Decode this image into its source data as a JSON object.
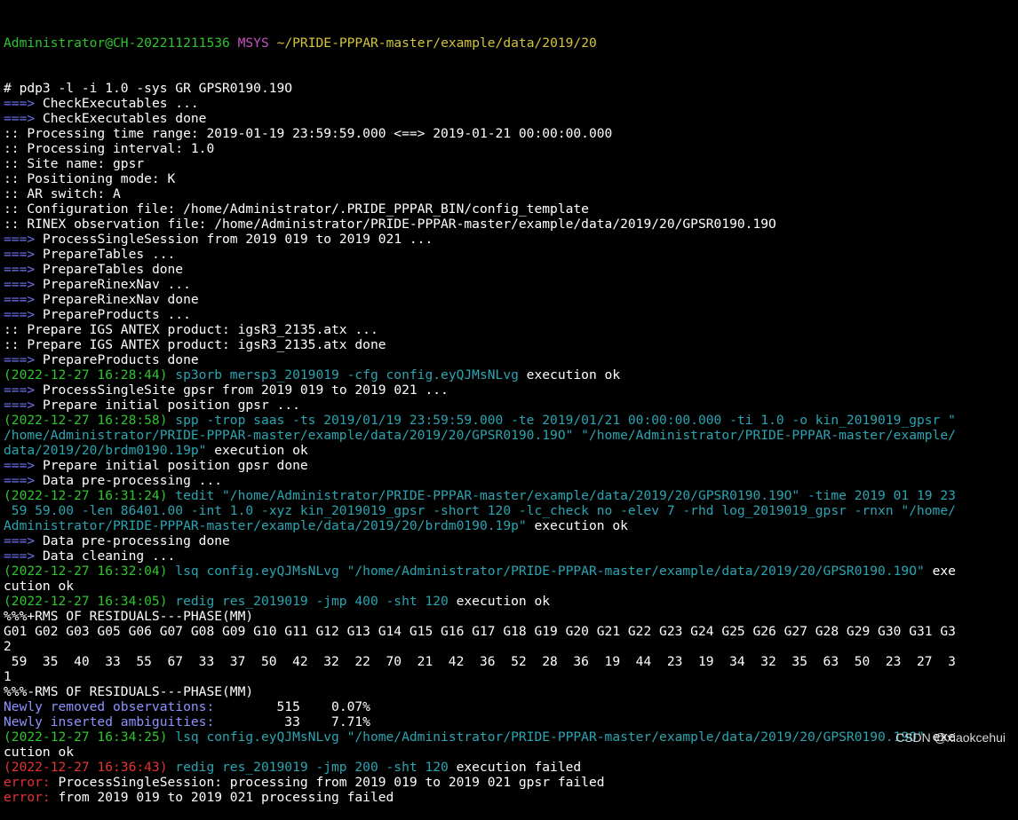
{
  "colors": {
    "background": "#000000",
    "default_text": "#ffffff",
    "prompt_user": "#2ec52e",
    "prompt_msys": "#c552c5",
    "prompt_path": "#d4c43a",
    "arrow": "#6f74f2",
    "timestamp": "#2ec52e",
    "command": "#2aa5b2",
    "error": "#e83232",
    "stats_label": "#8f93ff"
  },
  "prompt": {
    "user": "Administrator@CH-202211211536",
    "msys": "MSYS",
    "path": "~/PRIDE-PPPAR-master/example/data/2019/20"
  },
  "lines": [
    {
      "segments": [
        {
          "text": "# pdp3 -l -i 1.0 -sys GR GPSR0190.19O",
          "color": "white"
        }
      ]
    },
    {
      "segments": [
        {
          "text": "===>",
          "color": "blue"
        },
        {
          "text": " CheckExecutables ...",
          "color": "white"
        }
      ]
    },
    {
      "segments": [
        {
          "text": "===>",
          "color": "blue"
        },
        {
          "text": " CheckExecutables done",
          "color": "white"
        }
      ]
    },
    {
      "segments": [
        {
          "text": ":: Processing time range: 2019-01-19 23:59:59.000 <==> 2019-01-21 00:00:00.000",
          "color": "white"
        }
      ]
    },
    {
      "segments": [
        {
          "text": ":: Processing interval: 1.0",
          "color": "white"
        }
      ]
    },
    {
      "segments": [
        {
          "text": ":: Site name: gpsr",
          "color": "white"
        }
      ]
    },
    {
      "segments": [
        {
          "text": ":: Positioning mode: K",
          "color": "white"
        }
      ]
    },
    {
      "segments": [
        {
          "text": ":: AR switch: A",
          "color": "white"
        }
      ]
    },
    {
      "segments": [
        {
          "text": ":: Configuration file: /home/Administrator/.PRIDE_PPPAR_BIN/config_template",
          "color": "white"
        }
      ]
    },
    {
      "segments": [
        {
          "text": ":: RINEX observation file: /home/Administrator/PRIDE-PPPAR-master/example/data/2019/20/GPSR0190.19O",
          "color": "white"
        }
      ]
    },
    {
      "segments": [
        {
          "text": "===>",
          "color": "blue"
        },
        {
          "text": " ProcessSingleSession from 2019 019 to 2019 021 ...",
          "color": "white"
        }
      ]
    },
    {
      "segments": [
        {
          "text": "===>",
          "color": "blue"
        },
        {
          "text": " PrepareTables ...",
          "color": "white"
        }
      ]
    },
    {
      "segments": [
        {
          "text": "===>",
          "color": "blue"
        },
        {
          "text": " PrepareTables done",
          "color": "white"
        }
      ]
    },
    {
      "segments": [
        {
          "text": "===>",
          "color": "blue"
        },
        {
          "text": " PrepareRinexNav ...",
          "color": "white"
        }
      ]
    },
    {
      "segments": [
        {
          "text": "===>",
          "color": "blue"
        },
        {
          "text": " PrepareRinexNav done",
          "color": "white"
        }
      ]
    },
    {
      "segments": [
        {
          "text": "===>",
          "color": "blue"
        },
        {
          "text": " PrepareProducts ...",
          "color": "white"
        }
      ]
    },
    {
      "segments": [
        {
          "text": ":: Prepare IGS ANTEX product: igsR3_2135.atx ...",
          "color": "white"
        }
      ]
    },
    {
      "segments": [
        {
          "text": ":: Prepare IGS ANTEX product: igsR3_2135.atx done",
          "color": "white"
        }
      ]
    },
    {
      "segments": [
        {
          "text": "===>",
          "color": "blue"
        },
        {
          "text": " PrepareProducts done",
          "color": "white"
        }
      ]
    },
    {
      "segments": [
        {
          "text": "(2022-12-27 16:28:44) ",
          "color": "green"
        },
        {
          "text": "sp3orb mersp3_2019019 -cfg config.eyQJMsNLvg",
          "color": "teal"
        },
        {
          "text": " execution ok",
          "color": "white"
        }
      ]
    },
    {
      "segments": [
        {
          "text": "===>",
          "color": "blue"
        },
        {
          "text": " ProcessSingleSite gpsr from 2019 019 to 2019 021 ...",
          "color": "white"
        }
      ]
    },
    {
      "segments": [
        {
          "text": "===>",
          "color": "blue"
        },
        {
          "text": " Prepare initial position gpsr ...",
          "color": "white"
        }
      ]
    },
    {
      "segments": [
        {
          "text": "(2022-12-27 16:28:58) ",
          "color": "green"
        },
        {
          "text": "spp -trop saas -ts 2019/01/19 23:59:59.000 -te 2019/01/21 00:00:00.000 -ti 1.0 -o kin_2019019_gpsr \"",
          "color": "teal"
        }
      ]
    },
    {
      "segments": [
        {
          "text": "/home/Administrator/PRIDE-PPPAR-master/example/data/2019/20/GPSR0190.19O\" \"/home/Administrator/PRIDE-PPPAR-master/example/",
          "color": "teal"
        }
      ]
    },
    {
      "segments": [
        {
          "text": "data/2019/20/brdm0190.19p\"",
          "color": "teal"
        },
        {
          "text": " execution ok",
          "color": "white"
        }
      ]
    },
    {
      "segments": [
        {
          "text": "===>",
          "color": "blue"
        },
        {
          "text": " Prepare initial position gpsr done",
          "color": "white"
        }
      ]
    },
    {
      "segments": [
        {
          "text": "===>",
          "color": "blue"
        },
        {
          "text": " Data pre-processing ...",
          "color": "white"
        }
      ]
    },
    {
      "segments": [
        {
          "text": "(2022-12-27 16:31:24) ",
          "color": "green"
        },
        {
          "text": "tedit \"/home/Administrator/PRIDE-PPPAR-master/example/data/2019/20/GPSR0190.19O\" -time 2019 01 19 23",
          "color": "teal"
        }
      ]
    },
    {
      "segments": [
        {
          "text": " 59 59.00 -len 86401.00 -int 1.0 -xyz kin_2019019_gpsr -short 120 -lc_check no -elev 7 -rhd log_2019019_gpsr -rnxn \"/home/",
          "color": "teal"
        }
      ]
    },
    {
      "segments": [
        {
          "text": "Administrator/PRIDE-PPPAR-master/example/data/2019/20/brdm0190.19p\"",
          "color": "teal"
        },
        {
          "text": " execution ok",
          "color": "white"
        }
      ]
    },
    {
      "segments": [
        {
          "text": "===>",
          "color": "blue"
        },
        {
          "text": " Data pre-processing done",
          "color": "white"
        }
      ]
    },
    {
      "segments": [
        {
          "text": "===>",
          "color": "blue"
        },
        {
          "text": " Data cleaning ...",
          "color": "white"
        }
      ]
    },
    {
      "segments": [
        {
          "text": "(2022-12-27 16:32:04) ",
          "color": "green"
        },
        {
          "text": "lsq config.eyQJMsNLvg \"/home/Administrator/PRIDE-PPPAR-master/example/data/2019/20/GPSR0190.19O\"",
          "color": "teal"
        },
        {
          "text": " exe",
          "color": "white"
        }
      ]
    },
    {
      "segments": [
        {
          "text": "cution ok",
          "color": "white"
        }
      ]
    },
    {
      "segments": [
        {
          "text": "(2022-12-27 16:34:05) ",
          "color": "green"
        },
        {
          "text": "redig res_2019019 -jmp 400 -sht 120",
          "color": "teal"
        },
        {
          "text": " execution ok",
          "color": "white"
        }
      ]
    },
    {
      "segments": [
        {
          "text": "%%%+RMS OF RESIDUALS---PHASE(MM)",
          "color": "white"
        }
      ]
    },
    {
      "segments": [
        {
          "text": "G01 G02 G03 G05 G06 G07 G08 G09 G10 G11 G12 G13 G14 G15 G16 G17 G18 G19 G20 G21 G22 G23 G24 G25 G26 G27 G28 G29 G30 G31 G3",
          "color": "white"
        }
      ]
    },
    {
      "segments": [
        {
          "text": "2",
          "color": "white"
        }
      ]
    },
    {
      "segments": [
        {
          "text": " 59  35  40  33  55  67  33  37  50  42  32  22  70  21  42  36  52  28  36  19  44  23  19  34  32  35  63  50  23  27  3",
          "color": "white"
        }
      ]
    },
    {
      "segments": [
        {
          "text": "1",
          "color": "white"
        }
      ]
    },
    {
      "segments": [
        {
          "text": "%%%-RMS OF RESIDUALS---PHASE(MM)",
          "color": "white"
        }
      ]
    },
    {
      "segments": [
        {
          "text": "Newly removed observations:",
          "color": "ltblue"
        },
        {
          "text": "        515    0.07%",
          "color": "white"
        }
      ]
    },
    {
      "segments": [
        {
          "text": "Newly inserted ambiguities:",
          "color": "ltblue"
        },
        {
          "text": "         33    7.71%",
          "color": "white"
        }
      ]
    },
    {
      "segments": [
        {
          "text": "(2022-12-27 16:34:25) ",
          "color": "green"
        },
        {
          "text": "lsq config.eyQJMsNLvg \"/home/Administrator/PRIDE-PPPAR-master/example/data/2019/20/GPSR0190.19O\"",
          "color": "teal"
        },
        {
          "text": " exe",
          "color": "white"
        }
      ]
    },
    {
      "segments": [
        {
          "text": "cution ok",
          "color": "white"
        }
      ]
    },
    {
      "segments": [
        {
          "text": "(2022-12-27 16:36:43) ",
          "color": "red"
        },
        {
          "text": "redig res_2019019 -jmp 200 -sht 120",
          "color": "teal"
        },
        {
          "text": " execution failed",
          "color": "white"
        }
      ]
    },
    {
      "segments": [
        {
          "text": "error:",
          "color": "red"
        },
        {
          "text": " ProcessSingleSession: processing from 2019 019 to 2019 021 gpsr failed",
          "color": "white"
        }
      ]
    },
    {
      "segments": [
        {
          "text": "error:",
          "color": "red"
        },
        {
          "text": " from 2019 019 to 2019 021 processing failed",
          "color": "white"
        }
      ]
    }
  ],
  "watermark": "CSDN @xiaokcehui"
}
